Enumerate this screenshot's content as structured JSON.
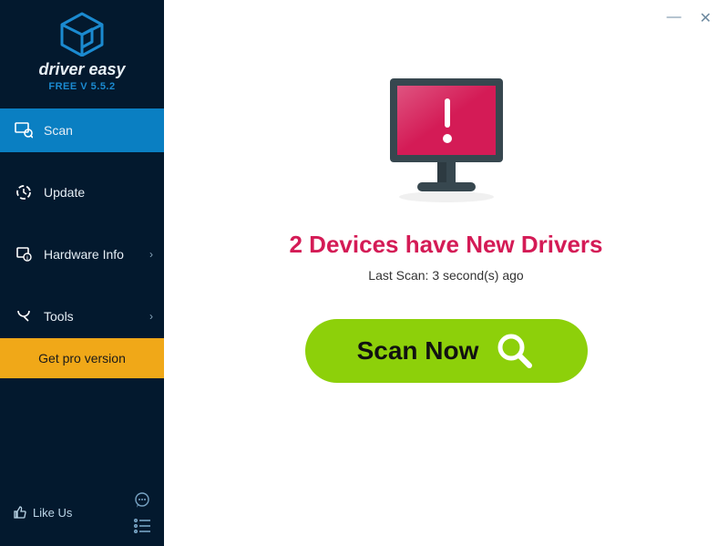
{
  "brand": {
    "name": "driver easy",
    "version_label": "FREE V 5.5.2"
  },
  "nav": {
    "scan": "Scan",
    "update": "Update",
    "hardware_info": "Hardware Info",
    "tools": "Tools"
  },
  "get_pro_label": "Get pro version",
  "like_us_label": "Like Us",
  "headline": "2 Devices have New Drivers",
  "last_scan": "Last Scan: 3 second(s) ago",
  "scan_button_label": "Scan Now",
  "colors": {
    "accent": "#d41b56",
    "scan_green": "#8dd00a",
    "sidebar_active": "#0a7fc2"
  },
  "window": {
    "minimize": "—",
    "close": "✕"
  }
}
